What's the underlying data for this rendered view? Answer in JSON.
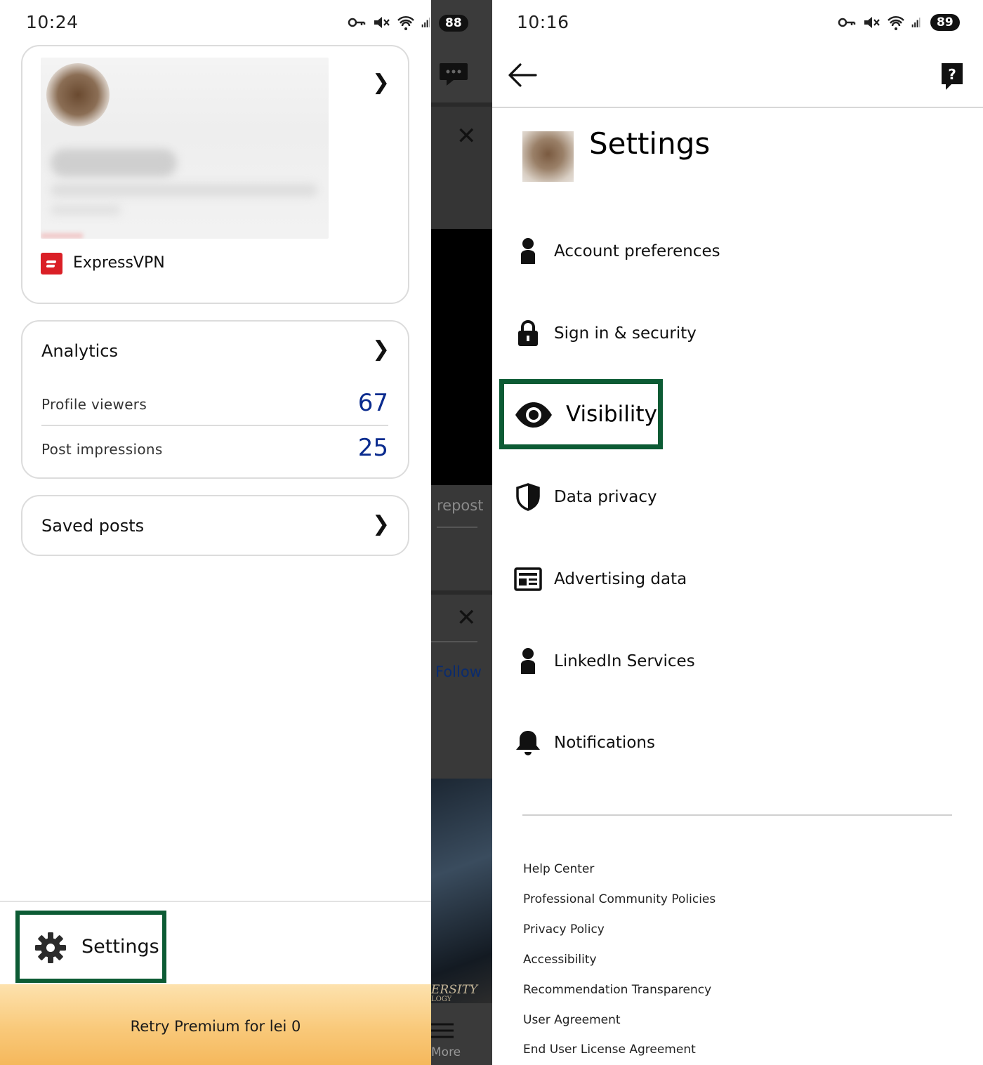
{
  "left_screen": {
    "status": {
      "time": "10:24",
      "battery": "88"
    },
    "profile": {
      "company_name": "ExpressVPN"
    },
    "analytics": {
      "title": "Analytics",
      "rows": [
        {
          "label": "Profile viewers",
          "value": "67"
        },
        {
          "label": "Post impressions",
          "value": "25"
        }
      ]
    },
    "saved_posts": {
      "title": "Saved posts"
    },
    "settings_button": {
      "label": "Settings"
    },
    "premium_banner": {
      "label": "Retry Premium for lei 0"
    }
  },
  "middle_strip": {
    "repost_text": "repost",
    "follow_text": "Follow",
    "more_text": "More",
    "ersity_text": "ERSITY",
    "ogy_text": "LOGY"
  },
  "right_screen": {
    "status": {
      "time": "10:16",
      "battery": "89"
    },
    "title": "Settings",
    "menu": [
      {
        "label": "Account preferences",
        "icon": "person-icon"
      },
      {
        "label": "Sign in & security",
        "icon": "lock-icon"
      },
      {
        "label": "Visibility",
        "icon": "eye-icon"
      },
      {
        "label": "Data privacy",
        "icon": "shield-icon"
      },
      {
        "label": "Advertising data",
        "icon": "newspaper-icon"
      },
      {
        "label": "LinkedIn Services",
        "icon": "person-icon"
      },
      {
        "label": "Notifications",
        "icon": "bell-icon"
      }
    ],
    "footer_links": [
      "Help Center",
      "Professional Community Policies",
      "Privacy Policy",
      "Accessibility",
      "Recommendation Transparency",
      "User Agreement",
      "End User License Agreement"
    ]
  },
  "colors": {
    "highlight_border": "#0c5b34",
    "stat_value": "#0a2b8e",
    "premium_banner": "#f9c97a",
    "vpn_red": "#da1f26"
  }
}
